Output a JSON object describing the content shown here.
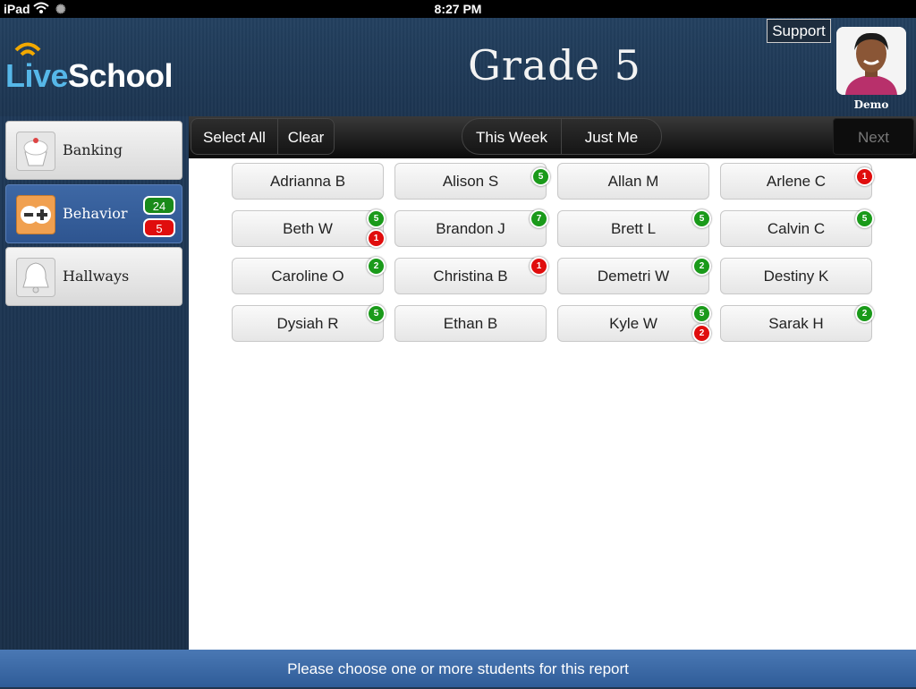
{
  "status_bar": {
    "device": "iPad",
    "time": "8:27 PM"
  },
  "header": {
    "logo_live": "Live",
    "logo_school": "School",
    "title": "Grade 5",
    "support_label": "Support",
    "user_name": "Demo"
  },
  "sidebar": {
    "items": [
      {
        "label": "Banking",
        "icon": "cupcake-icon"
      },
      {
        "label": "Behavior",
        "icon": "plus-minus-icon",
        "positive": "24",
        "negative": "5"
      },
      {
        "label": "Hallways",
        "icon": "bell-icon"
      }
    ]
  },
  "toolbar": {
    "select_all": "Select All",
    "clear": "Clear",
    "this_week": "This Week",
    "just_me": "Just Me",
    "next": "Next"
  },
  "students": [
    {
      "name": "Adrianna B"
    },
    {
      "name": "Alison S",
      "positive": "5"
    },
    {
      "name": "Allan M"
    },
    {
      "name": "Arlene C",
      "negative": "1"
    },
    {
      "name": "Beth W",
      "positive": "5",
      "negative": "1"
    },
    {
      "name": "Brandon J",
      "positive": "7"
    },
    {
      "name": "Brett L",
      "positive": "5"
    },
    {
      "name": "Calvin C",
      "positive": "5"
    },
    {
      "name": "Caroline O",
      "positive": "2"
    },
    {
      "name": "Christina B",
      "negative": "1"
    },
    {
      "name": "Demetri W",
      "positive": "2"
    },
    {
      "name": "Destiny K"
    },
    {
      "name": "Dysiah R",
      "positive": "5"
    },
    {
      "name": "Ethan B"
    },
    {
      "name": "Kyle W",
      "positive": "5",
      "negative": "2"
    },
    {
      "name": "Sarak H",
      "positive": "2"
    }
  ],
  "footer": {
    "message": "Please choose one or more students for this report"
  },
  "colors": {
    "positive": "#1a9a1a",
    "negative": "#e00d0d",
    "accent": "#3e68a5"
  }
}
